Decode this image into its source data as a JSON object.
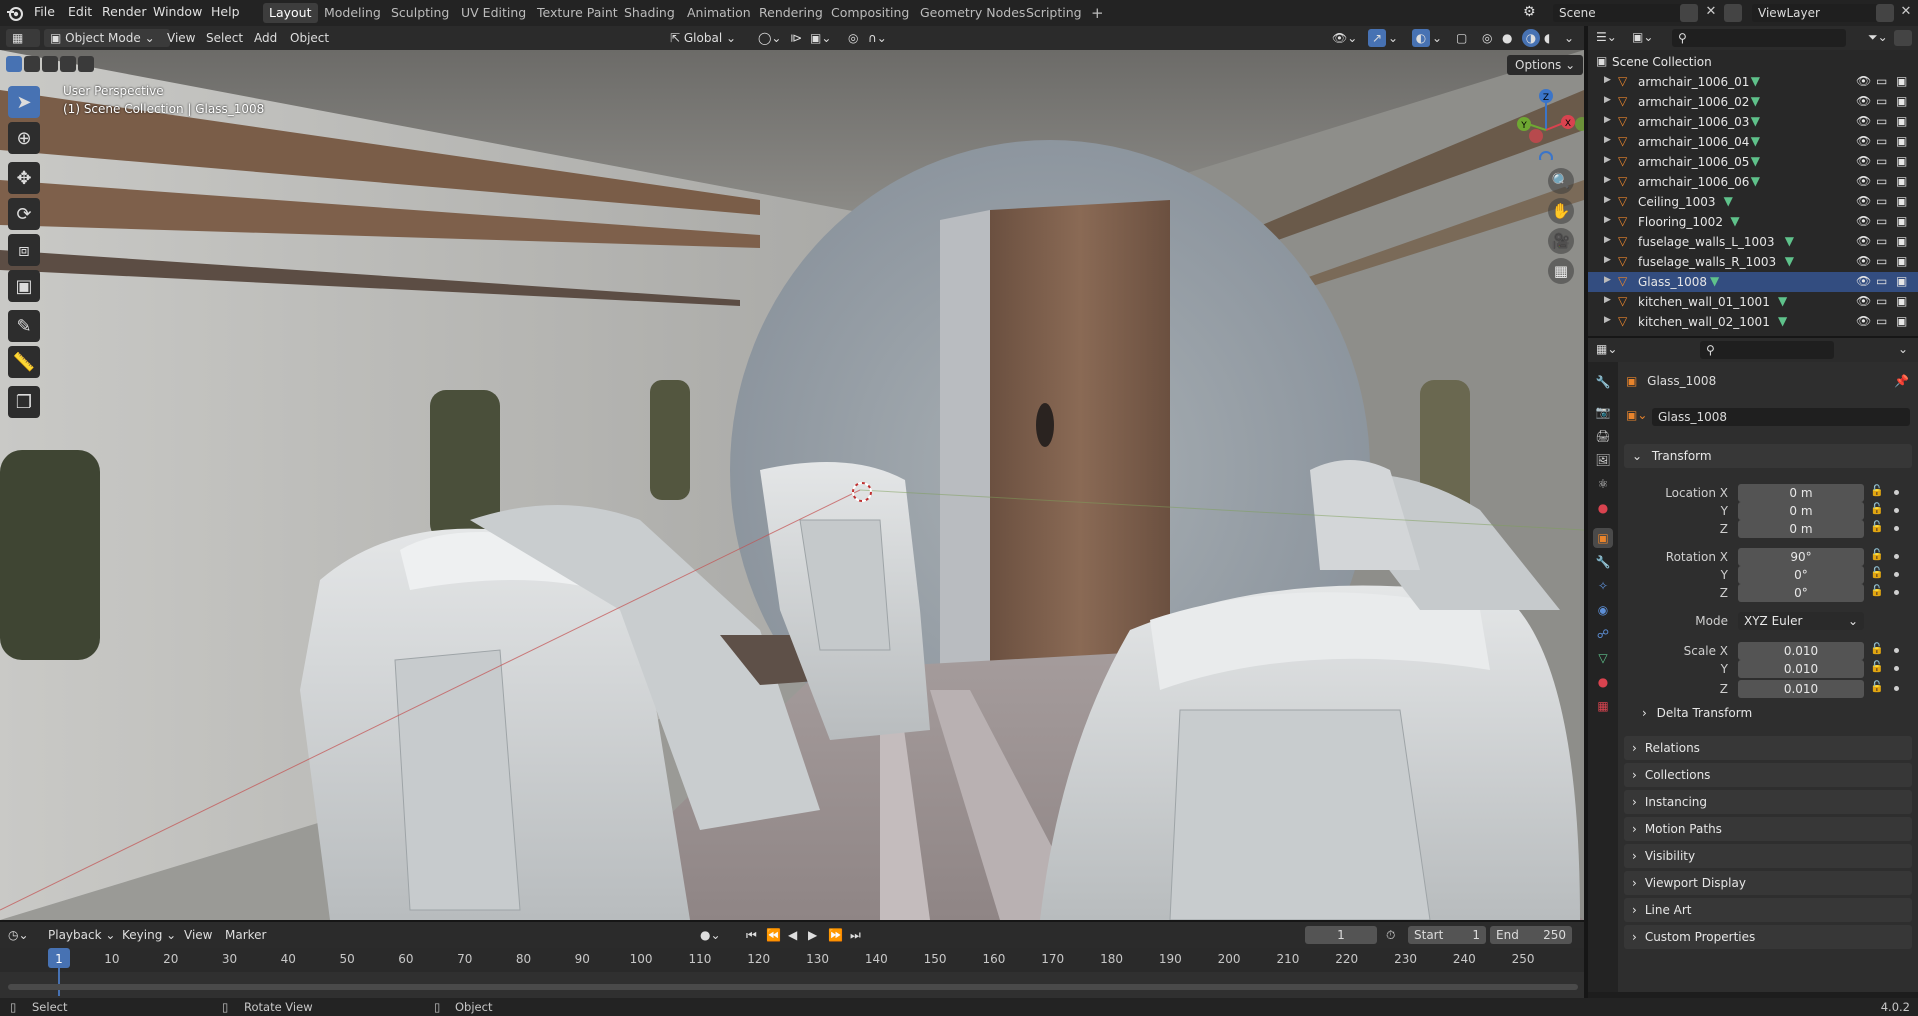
{
  "topbar": {
    "menus": [
      "File",
      "Edit",
      "Render",
      "Window",
      "Help"
    ],
    "workspaces": [
      "Layout",
      "Modeling",
      "Sculpting",
      "UV Editing",
      "Texture Paint",
      "Shading",
      "Animation",
      "Rendering",
      "Compositing",
      "Geometry Nodes",
      "Scripting"
    ],
    "active_workspace": "Layout",
    "add_tab": "+",
    "scene": "Scene",
    "view_layer": "ViewLayer"
  },
  "viewport": {
    "mode": "Object Mode",
    "menus": [
      "View",
      "Select",
      "Add",
      "Object"
    ],
    "transform_orientation": "Global",
    "options_label": "Options",
    "overlay_title": "User Perspective",
    "overlay_subtitle": "(1) Scene Collection | Glass_1008",
    "gizmo": {
      "z": "Z",
      "y": "Y",
      "x": "X"
    }
  },
  "outliner": {
    "root": "Scene Collection",
    "items": [
      {
        "name": "armchair_1006_01",
        "selected": false
      },
      {
        "name": "armchair_1006_02",
        "selected": false
      },
      {
        "name": "armchair_1006_03",
        "selected": false
      },
      {
        "name": "armchair_1006_04",
        "selected": false
      },
      {
        "name": "armchair_1006_05",
        "selected": false
      },
      {
        "name": "armchair_1006_06",
        "selected": false
      },
      {
        "name": "Ceiling_1003",
        "selected": false
      },
      {
        "name": "Flooring_1002",
        "selected": false
      },
      {
        "name": "fuselage_walls_L_1003",
        "selected": false
      },
      {
        "name": "fuselage_walls_R_1003",
        "selected": false
      },
      {
        "name": "Glass_1008",
        "selected": true
      },
      {
        "name": "kitchen_wall_01_1001",
        "selected": false
      },
      {
        "name": "kitchen_wall_02_1001",
        "selected": false
      }
    ]
  },
  "properties": {
    "object_name": "Glass_1008",
    "datablock_name": "Glass_1008",
    "transform_label": "Transform",
    "location": {
      "label": "Location X",
      "x": "0 m",
      "y": "0 m",
      "z": "0 m"
    },
    "rotation": {
      "label": "Rotation X",
      "x": "90°",
      "y": "0°",
      "z": "0°"
    },
    "mode": {
      "label": "Mode",
      "value": "XYZ Euler"
    },
    "scale": {
      "label": "Scale X",
      "x": "0.010",
      "y": "0.010",
      "z": "0.010"
    },
    "axis_y": "Y",
    "axis_z": "Z",
    "delta_transform": "Delta Transform",
    "panels": [
      "Relations",
      "Collections",
      "Instancing",
      "Motion Paths",
      "Visibility",
      "Viewport Display",
      "Line Art",
      "Custom Properties"
    ]
  },
  "timeline": {
    "menus": [
      "Playback",
      "Keying",
      "View",
      "Marker"
    ],
    "current_frame": "1",
    "start_label": "Start",
    "start": "1",
    "end_label": "End",
    "end": "250",
    "ticks": [
      "1",
      "10",
      "20",
      "30",
      "40",
      "50",
      "60",
      "70",
      "80",
      "90",
      "100",
      "110",
      "120",
      "130",
      "140",
      "150",
      "160",
      "170",
      "180",
      "190",
      "200",
      "210",
      "220",
      "230",
      "240",
      "250"
    ]
  },
  "statusbar": {
    "select": "Select",
    "rotate": "Rotate View",
    "object": "Object",
    "version": "4.0.2"
  },
  "colors": {
    "accent": "#4772b3",
    "selection": "#334d80",
    "object_orange": "#e8842c",
    "mesh_green": "#5fc28b"
  }
}
